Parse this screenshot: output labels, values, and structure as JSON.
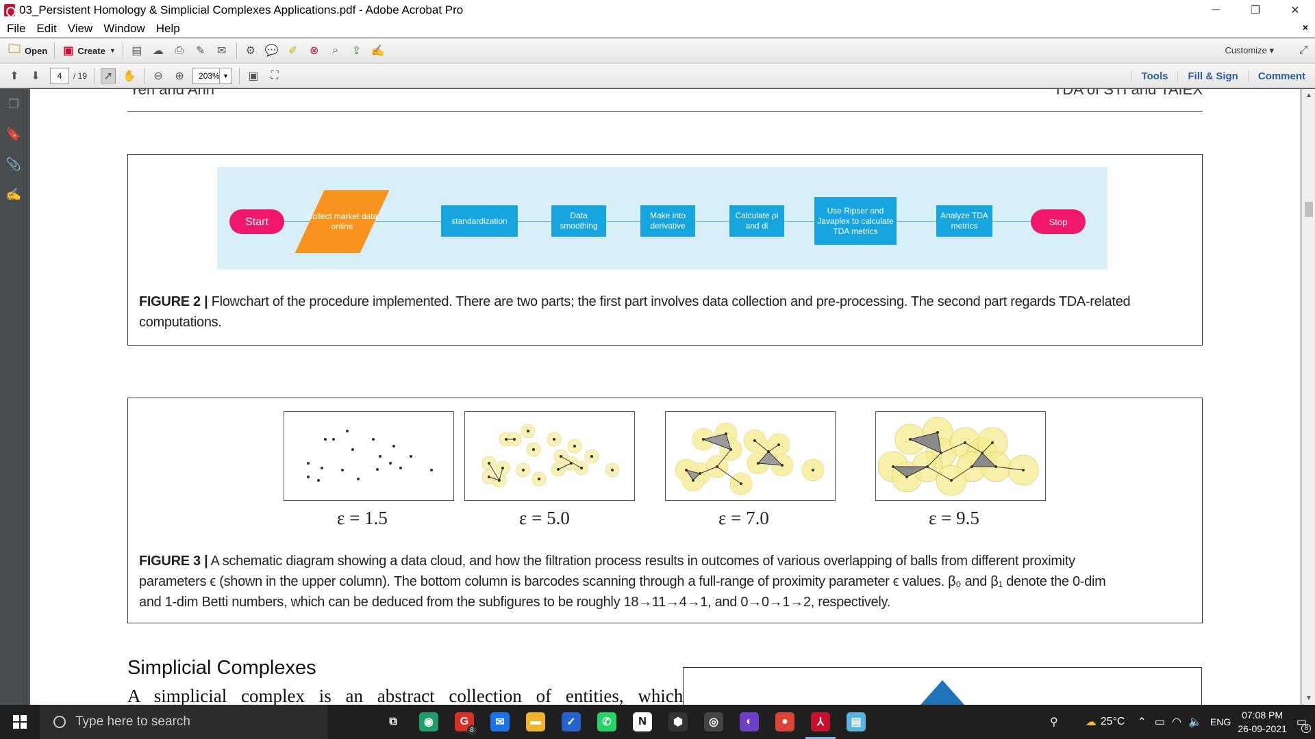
{
  "window": {
    "title": "03_Persistent Homology & Simplicial Complexes Applications.pdf - Adobe Acrobat Pro",
    "minimize": "─",
    "restore": "❐",
    "close": "✕",
    "doc_close": "×"
  },
  "menu": [
    "File",
    "Edit",
    "View",
    "Window",
    "Help"
  ],
  "toolbar": {
    "open_label": "Open",
    "create_label": "Create",
    "customize_label": "Customize",
    "page_current": "4",
    "page_total": "/ 19",
    "zoom": "203%",
    "tools_label": "Tools",
    "fillsign_label": "Fill & Sign",
    "comment_label": "Comment"
  },
  "page": {
    "header_left": "Yeh and Anh",
    "header_right": "TDA of STI and TAIEX",
    "figure2": {
      "nodes": {
        "start": "Start",
        "collect": "Collect market data online",
        "standardization": "standardization",
        "smoothing": "Data smoothing",
        "derivative": "Make into derivative",
        "calculate": "Calculate ρi and di",
        "ripser": "Use Ripser and Javaplex to calculate TDA metrics",
        "analyze": "Analyze TDA metrics",
        "stop": "Stop"
      },
      "caption_label": "FIGURE 2 |",
      "caption_text": " Flowchart of the procedure implemented. There are two parts; the first part involves data collection and pre-processing. The second part regards TDA-related computations."
    },
    "figure3": {
      "eps_labels": [
        "ε = 1.5",
        "ε = 5.0",
        "ε = 7.0",
        "ε = 9.5"
      ],
      "caption_label": "FIGURE 3 |",
      "caption_line1": " A schematic diagram showing a data cloud, and how the filtration process results in outcomes of various overlapping of balls from different proximity",
      "caption_line2": "parameters ϵ (shown in the upper column). The bottom column is barcodes scanning through a full-range of proximity parameter ϵ values. β₀ and β₁ denote the 0-dim",
      "caption_line3": "and 1-dim Betti numbers, which can be deduced from the subfigures to be roughly 18→11→4→1, and 0→0→1→2, respectively."
    },
    "section_title": "Simplicial Complexes",
    "body_line": "A simplicial complex is an abstract collection of entities, which"
  },
  "taskbar": {
    "search_placeholder": "Type here to search",
    "apps": [
      {
        "name": "task-view",
        "glyph": "⧉",
        "color": "#1f1f1f"
      },
      {
        "name": "green-app",
        "glyph": "◉",
        "color": "#1e9e6a"
      },
      {
        "name": "gmail",
        "glyph": "G",
        "color": "#d93025",
        "badge": "8"
      },
      {
        "name": "mail",
        "glyph": "✉",
        "color": "#1a73e8"
      },
      {
        "name": "file-explorer",
        "glyph": "▬",
        "color": "#f0b429"
      },
      {
        "name": "todo",
        "glyph": "✓",
        "color": "#2564cf"
      },
      {
        "name": "whatsapp",
        "glyph": "✆",
        "color": "#25d366"
      },
      {
        "name": "notion",
        "glyph": "N",
        "color": "#ffffff"
      },
      {
        "name": "shield-app",
        "glyph": "⬢",
        "color": "#333333"
      },
      {
        "name": "obs",
        "glyph": "◎",
        "color": "#444444"
      },
      {
        "name": "github",
        "glyph": "◐",
        "color": "#6e40c9"
      },
      {
        "name": "chrome",
        "glyph": "●",
        "color": "#db4437"
      },
      {
        "name": "acrobat",
        "glyph": "⅄",
        "color": "#c8102e"
      },
      {
        "name": "notepad",
        "glyph": "▤",
        "color": "#5ab4e0"
      }
    ],
    "weather": "25°C",
    "language": "ENG",
    "time": "07:08 PM",
    "date": "26-09-2021",
    "notification_badge": "8"
  }
}
